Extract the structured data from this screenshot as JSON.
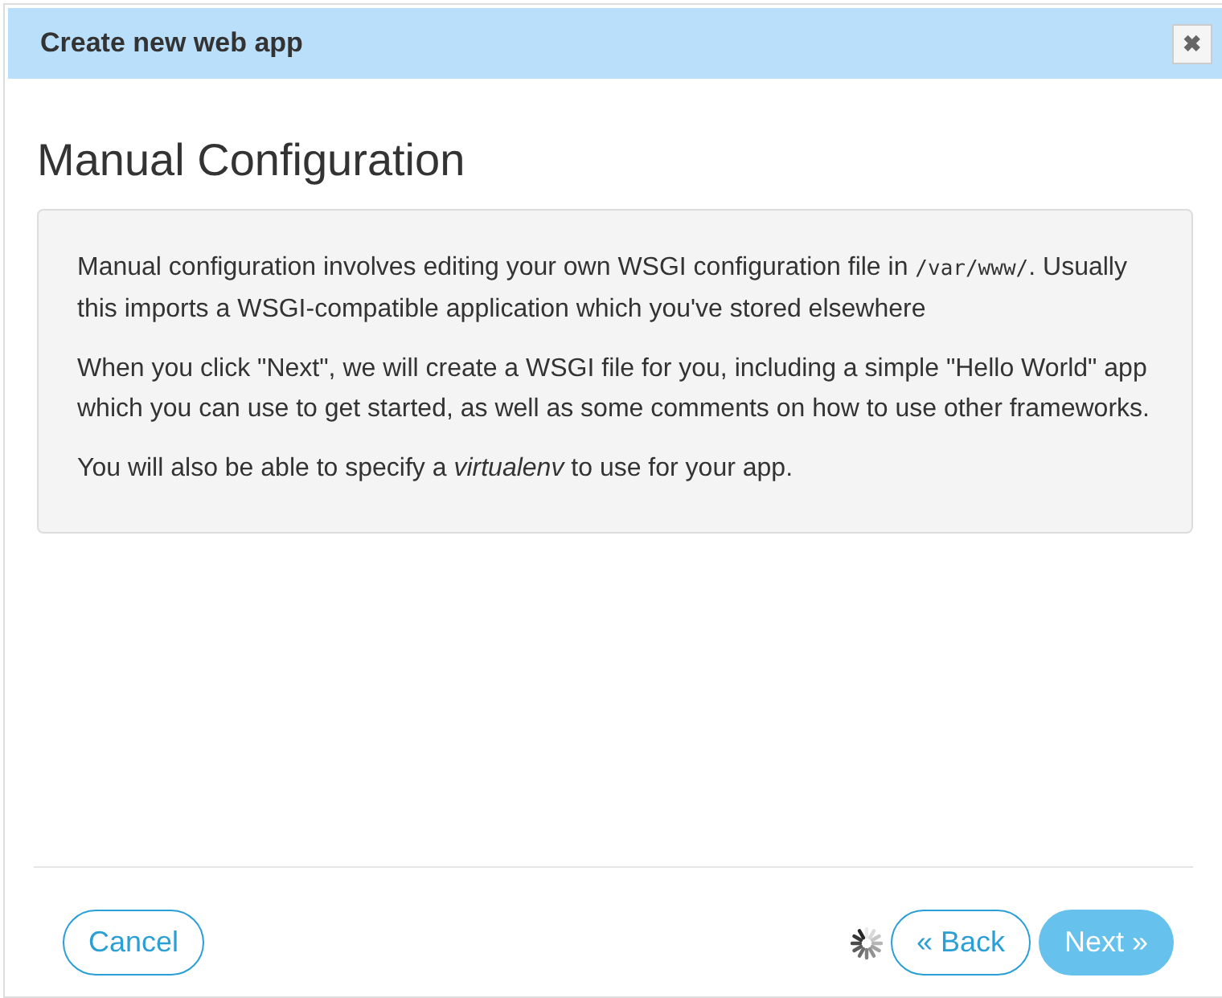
{
  "dialog": {
    "title": "Create new web app",
    "close_label": "✖"
  },
  "heading": "Manual Configuration",
  "info_paragraphs": [
    [
      {
        "kind": "text",
        "text": "Manual configuration involves editing your own WSGI configuration file in "
      },
      {
        "kind": "code",
        "text": "/var/www/"
      },
      {
        "kind": "text",
        "text": ". Usually this imports a WSGI-compatible application which you've stored elsewhere"
      }
    ],
    [
      {
        "kind": "text",
        "text": "When you click \"Next\", we will create a WSGI file for you, including a simple \"Hello World\" app which you can use to get started, as well as some comments on how to use other frameworks."
      }
    ],
    [
      {
        "kind": "text",
        "text": "You will also be able to specify a *virtualenv* to use for your app."
      }
    ]
  ],
  "footer": {
    "cancel": "Cancel",
    "loading": true,
    "back": "« Back",
    "next": "Next »",
    "next_disabled": true
  }
}
